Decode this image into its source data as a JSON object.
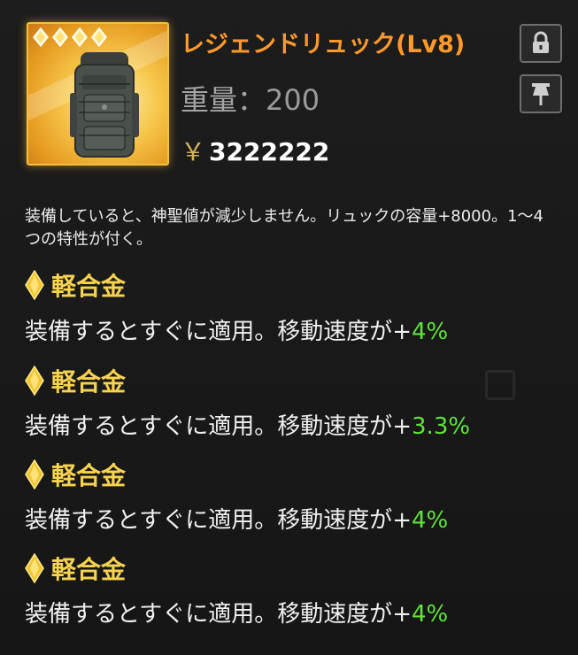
{
  "item": {
    "title": "レジェンドリュック(Lv8)",
    "weight_label": "重量",
    "weight_sep": "：",
    "weight_value": "200",
    "price_symbol": "￥",
    "price_value": "3222222",
    "star_count": 4,
    "description": "装備していると、神聖値が減少しません。リュックの容量+8000。1～4つの特性が付く。"
  },
  "buttons": {
    "lock_icon": "lock-icon",
    "pin_icon": "pin-icon"
  },
  "traits": [
    {
      "name": "軽合金",
      "text": "装備するとすぐに適用。移動速度が+",
      "value": "4%"
    },
    {
      "name": "軽合金",
      "text": "装備するとすぐに適用。移動速度が+",
      "value": "3.3%"
    },
    {
      "name": "軽合金",
      "text": "装備するとすぐに適用。移動速度が+",
      "value": "4%"
    },
    {
      "name": "軽合金",
      "text": "装備するとすぐに適用。移動速度が+",
      "value": "4%"
    }
  ],
  "colors": {
    "title": "#ff9a2a",
    "trait_name": "#f7d34f",
    "positive_value": "#5fe33a",
    "frame_gold": "#f4c23a"
  }
}
